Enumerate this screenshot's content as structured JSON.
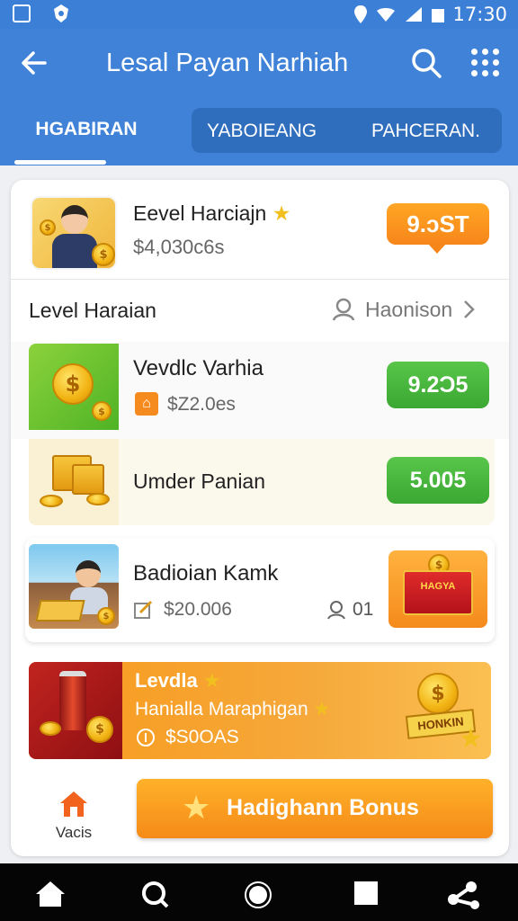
{
  "status_bar": {
    "time": "17:30"
  },
  "header": {
    "title": "Lesal Payan Narhiah",
    "icons": [
      "back-arrow-icon",
      "search-icon",
      "grid-menu-icon"
    ]
  },
  "tabs": [
    {
      "label": "HGABIRAN",
      "active": true
    },
    {
      "label": "YABOIEANG",
      "active": false
    },
    {
      "label": "PAHCERAN.",
      "active": false
    }
  ],
  "featured": {
    "title": "Eevel Harciajn",
    "price": "$4,030c6s",
    "badge_value": "9.ɔST"
  },
  "section": {
    "label": "Level Haraian",
    "link": "Haonison"
  },
  "items": [
    {
      "title": "Vevdlc Varhia",
      "price": "$Z2.0es",
      "button": "9.2Ͻ5"
    },
    {
      "title": "Umder Panian",
      "button": "5.005"
    },
    {
      "title": "Badioian Kamk",
      "price": "$20.006",
      "count": "01",
      "tag": "HAGYA"
    }
  ],
  "banner": {
    "title": "Levdla",
    "subtitle": "Hanialla Maraphigan",
    "price": "$S0OAS",
    "tag": "HONKIN"
  },
  "bottom": {
    "nav_label": "Vacis",
    "cta_label": "Hadighann Bonus"
  },
  "colors": {
    "primary": "#3f82d8",
    "accent_orange": "#f7861a",
    "accent_green": "#3aa832"
  }
}
